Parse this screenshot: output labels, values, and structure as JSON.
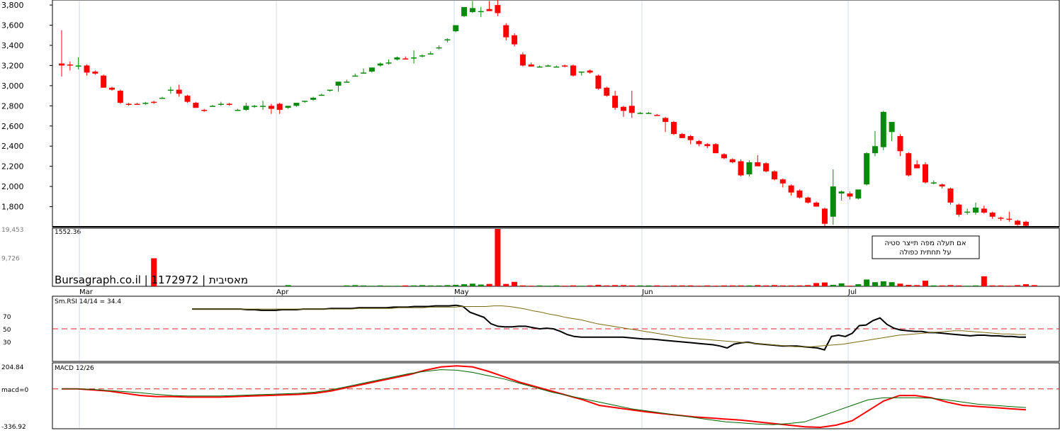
{
  "chart_data": [
    {
      "type": "candlestick",
      "name_label": "",
      "ylim": [
        1600,
        3850
      ],
      "y_ticks": [
        "3,800",
        "3,600",
        "3,400",
        "3,200",
        "3,000",
        "2,800",
        "2,600",
        "2,400",
        "2,200",
        "2,000",
        "1,800"
      ],
      "y_tick_values": [
        3800,
        3600,
        3400,
        3200,
        3000,
        2800,
        2600,
        2400,
        2200,
        2000,
        1800
      ],
      "x_labels": [
        "Mar",
        "Apr",
        "May",
        "Jun",
        "Jul"
      ],
      "up_color": "#0a8a0a",
      "down_color": "#ff0000",
      "candles": [
        [
          3220,
          3550,
          3090,
          3200
        ],
        [
          3210,
          3240,
          3150,
          3200
        ],
        [
          3200,
          3280,
          3160,
          3200
        ],
        [
          3200,
          3210,
          3100,
          3130
        ],
        [
          3140,
          3150,
          3110,
          3120
        ],
        [
          3100,
          3110,
          2980,
          2980
        ],
        [
          2980,
          2990,
          2950,
          2960
        ],
        [
          2950,
          2960,
          2820,
          2830
        ],
        [
          2820,
          2830,
          2800,
          2810
        ],
        [
          2820,
          2830,
          2810,
          2810
        ],
        [
          2820,
          2840,
          2810,
          2830
        ],
        [
          2840,
          2850,
          2820,
          2830
        ],
        [
          2880,
          2890,
          2870,
          2880
        ],
        [
          2960,
          2990,
          2920,
          2960
        ],
        [
          2960,
          3010,
          2890,
          2920
        ],
        [
          2900,
          2910,
          2830,
          2840
        ],
        [
          2830,
          2840,
          2780,
          2780
        ],
        [
          2760,
          2770,
          2740,
          2750
        ],
        [
          2800,
          2810,
          2790,
          2800
        ],
        [
          2810,
          2840,
          2800,
          2820
        ],
        [
          2820,
          2830,
          2800,
          2810
        ],
        [
          2760,
          2770,
          2750,
          2760
        ],
        [
          2760,
          2830,
          2750,
          2800
        ],
        [
          2800,
          2810,
          2780,
          2800
        ],
        [
          2800,
          2850,
          2760,
          2800
        ],
        [
          2800,
          2820,
          2720,
          2770
        ],
        [
          2820,
          2830,
          2720,
          2760
        ],
        [
          2780,
          2800,
          2770,
          2800
        ],
        [
          2800,
          2830,
          2790,
          2830
        ],
        [
          2840,
          2850,
          2830,
          2850
        ],
        [
          2860,
          2890,
          2850,
          2880
        ],
        [
          2900,
          2920,
          2900,
          2910
        ],
        [
          2950,
          2960,
          2940,
          2960
        ],
        [
          3000,
          3040,
          2940,
          3040
        ],
        [
          3040,
          3060,
          3030,
          3040
        ],
        [
          3100,
          3120,
          3090,
          3100
        ],
        [
          3130,
          3170,
          3120,
          3130
        ],
        [
          3140,
          3180,
          3130,
          3180
        ],
        [
          3200,
          3230,
          3190,
          3220
        ],
        [
          3220,
          3260,
          3210,
          3230
        ],
        [
          3260,
          3290,
          3250,
          3280
        ],
        [
          3270,
          3290,
          3260,
          3260
        ],
        [
          3280,
          3350,
          3220,
          3280
        ],
        [
          3290,
          3310,
          3280,
          3300
        ],
        [
          3320,
          3340,
          3310,
          3320
        ],
        [
          3380,
          3400,
          3360,
          3380
        ],
        [
          3450,
          3470,
          3430,
          3460
        ],
        [
          3540,
          3600,
          3530,
          3600
        ],
        [
          3690,
          3780,
          3680,
          3780
        ],
        [
          3730,
          3840,
          3720,
          3770
        ],
        [
          3730,
          3780,
          3680,
          3740
        ],
        [
          3760,
          3840,
          3740,
          3740
        ],
        [
          3800,
          3850,
          3690,
          3720
        ],
        [
          3600,
          3620,
          3450,
          3480
        ],
        [
          3500,
          3520,
          3390,
          3410
        ],
        [
          3310,
          3330,
          3190,
          3200
        ],
        [
          3210,
          3230,
          3190,
          3190
        ],
        [
          3190,
          3200,
          3180,
          3190
        ],
        [
          3200,
          3210,
          3190,
          3200
        ],
        [
          3190,
          3200,
          3180,
          3190
        ],
        [
          3200,
          3210,
          3180,
          3190
        ],
        [
          3200,
          3210,
          3090,
          3100
        ],
        [
          3130,
          3140,
          3100,
          3140
        ],
        [
          3150,
          3160,
          3120,
          3130
        ],
        [
          3100,
          3110,
          2960,
          2970
        ],
        [
          2980,
          2990,
          2890,
          2900
        ],
        [
          2900,
          2950,
          2760,
          2780
        ],
        [
          2790,
          2800,
          2690,
          2750
        ],
        [
          2800,
          2950,
          2680,
          2730
        ],
        [
          2730,
          2740,
          2720,
          2730
        ],
        [
          2730,
          2740,
          2720,
          2730
        ],
        [
          2710,
          2720,
          2700,
          2700
        ],
        [
          2680,
          2690,
          2540,
          2640
        ],
        [
          2640,
          2650,
          2510,
          2520
        ],
        [
          2520,
          2530,
          2480,
          2480
        ],
        [
          2500,
          2510,
          2420,
          2460
        ],
        [
          2450,
          2460,
          2400,
          2420
        ],
        [
          2420,
          2430,
          2380,
          2400
        ],
        [
          2420,
          2430,
          2330,
          2330
        ],
        [
          2320,
          2330,
          2270,
          2280
        ],
        [
          2270,
          2280,
          2230,
          2240
        ],
        [
          2250,
          2270,
          2100,
          2110
        ],
        [
          2120,
          2260,
          2100,
          2240
        ],
        [
          2240,
          2310,
          2200,
          2200
        ],
        [
          2230,
          2240,
          2140,
          2150
        ],
        [
          2150,
          2160,
          2060,
          2070
        ],
        [
          2070,
          2080,
          1990,
          2030
        ],
        [
          2010,
          2020,
          1910,
          1940
        ],
        [
          1960,
          1970,
          1880,
          1890
        ],
        [
          1890,
          1900,
          1830,
          1840
        ],
        [
          1840,
          1850,
          1800,
          1800
        ],
        [
          1780,
          1790,
          1600,
          1630
        ],
        [
          1700,
          2170,
          1620,
          2000
        ],
        [
          1930,
          1960,
          1860,
          1950
        ],
        [
          1930,
          1950,
          1870,
          1900
        ],
        [
          1880,
          1960,
          1870,
          1970
        ],
        [
          2020,
          2340,
          2010,
          2330
        ],
        [
          2330,
          2550,
          2300,
          2400
        ],
        [
          2390,
          2750,
          2360,
          2740
        ],
        [
          2540,
          2640,
          2450,
          2640
        ],
        [
          2500,
          2520,
          2300,
          2350
        ],
        [
          2330,
          2340,
          2100,
          2110
        ],
        [
          2220,
          2260,
          2180,
          2180
        ],
        [
          2220,
          2240,
          2030,
          2040
        ],
        [
          2040,
          2060,
          2020,
          2040
        ],
        [
          2020,
          2030,
          1980,
          2000
        ],
        [
          1980,
          1990,
          1820,
          1840
        ],
        [
          1820,
          1830,
          1700,
          1720
        ],
        [
          1740,
          1780,
          1720,
          1750
        ],
        [
          1740,
          1840,
          1720,
          1790
        ],
        [
          1780,
          1810,
          1730,
          1740
        ],
        [
          1740,
          1750,
          1680,
          1700
        ],
        [
          1690,
          1700,
          1660,
          1680
        ],
        [
          1680,
          1750,
          1650,
          1670
        ],
        [
          1660,
          1670,
          1610,
          1620
        ],
        [
          1650,
          1660,
          1600,
          1610
        ]
      ]
    },
    {
      "type": "bar",
      "name_label": "Volume",
      "y_ticks": [
        "19,453",
        "9,726"
      ],
      "y_tick_values": [
        19453,
        9726
      ],
      "ylim": [
        0,
        19453
      ],
      "max_label": "1552.36",
      "watermark": "Bursagraph.co.il | 1172972 | מאסיבית",
      "note_line1": "אם תעלה מפה תייצר סטיה",
      "note_line2": "על תחתית כפולה",
      "values": [
        0,
        0,
        0,
        0,
        0,
        0,
        0,
        0,
        0,
        0,
        0,
        9500,
        0,
        0,
        0,
        0,
        0,
        0,
        0,
        0,
        0,
        0,
        0,
        0,
        0,
        0,
        0,
        400,
        0,
        0,
        0,
        0,
        0,
        0,
        300,
        400,
        300,
        200,
        300,
        200,
        200,
        300,
        300,
        400,
        300,
        300,
        400,
        500,
        700,
        900,
        600,
        800,
        21000,
        800,
        1500,
        300,
        200,
        300,
        200,
        300,
        200,
        300,
        200,
        300,
        500,
        300,
        400,
        400,
        300,
        300,
        300,
        300,
        200,
        300,
        300,
        300,
        200,
        300,
        200,
        300,
        300,
        300,
        300,
        400,
        300,
        400,
        300,
        300,
        300,
        400,
        1100,
        1300,
        500,
        1000,
        200,
        700,
        2300,
        1400,
        1700,
        1400,
        900,
        500,
        400,
        1900,
        300,
        300,
        400,
        300,
        200,
        300,
        3400,
        300,
        300,
        200,
        400,
        700,
        400
      ]
    },
    {
      "type": "line",
      "name_label": "Sm.RSI 14/14 = 34.4",
      "y_ticks": [
        "70",
        "50",
        "30"
      ],
      "y_tick_values": [
        70,
        50,
        30
      ],
      "ylim": [
        0,
        100
      ],
      "ref_level": 50,
      "x_labels": [
        "Mar",
        "Apr",
        "May",
        "Jun",
        "Jul"
      ],
      "series": [
        {
          "color": "#000000",
          "values": [
            81,
            81,
            81,
            81,
            81,
            81,
            81,
            81,
            80,
            80,
            79,
            79,
            79,
            80,
            80,
            80,
            81,
            81,
            81,
            81,
            82,
            82,
            82,
            82,
            83,
            83,
            83,
            83,
            83,
            84,
            84,
            84,
            85,
            85,
            85,
            86,
            86,
            86,
            87,
            85,
            76,
            72,
            68,
            58,
            54,
            53,
            53,
            54,
            54,
            52,
            50,
            51,
            50,
            46,
            41,
            38,
            37,
            37,
            37,
            37,
            37,
            37,
            37,
            36,
            35,
            34,
            34,
            33,
            32,
            31,
            30,
            29,
            28,
            27,
            26,
            25,
            23,
            20,
            26,
            28,
            29,
            27,
            26,
            25,
            24,
            23,
            23,
            23,
            22,
            21,
            20,
            17,
            38,
            40,
            38,
            43,
            55,
            56,
            63,
            67,
            57,
            51,
            48,
            47,
            46,
            46,
            44,
            44,
            43,
            42,
            41,
            40,
            39,
            40,
            40,
            39,
            39,
            38,
            38,
            37,
            37
          ]
        },
        {
          "color": "#7a6a12",
          "values": [
            81,
            81,
            81,
            81,
            81,
            81,
            81,
            81,
            81,
            81,
            81,
            81,
            81,
            81,
            81,
            81,
            81,
            81,
            81,
            81,
            81,
            82,
            82,
            82,
            82,
            82,
            83,
            83,
            83,
            83,
            84,
            84,
            84,
            84,
            85,
            85,
            85,
            85,
            86,
            86,
            85,
            83,
            81,
            78,
            76,
            73,
            71,
            68,
            66,
            64,
            61,
            58,
            56,
            54,
            52,
            50,
            48,
            46,
            44,
            42,
            40,
            38,
            36,
            35,
            34,
            33,
            32,
            31,
            30,
            29,
            28,
            27,
            26,
            25,
            24,
            23,
            22,
            22,
            22,
            23,
            24,
            25,
            26,
            28,
            30,
            32,
            34,
            36,
            38,
            40,
            41,
            42,
            43,
            44,
            45,
            46,
            47,
            47,
            46,
            45,
            44,
            43,
            42,
            42,
            41,
            41
          ]
        }
      ]
    },
    {
      "type": "line",
      "name_label": "MACD 12/26",
      "y_ticks": [
        "204.84",
        "macd=0",
        "-336.92"
      ],
      "y_tick_values": [
        204.84,
        0,
        -336.92
      ],
      "ylim": [
        -336.92,
        204.84
      ],
      "ref_level": 0,
      "series": [
        {
          "color": "#ff0000",
          "values": [
            0,
            0,
            -10,
            -20,
            -40,
            -60,
            -70,
            -70,
            -75,
            -75,
            -75,
            -70,
            -65,
            -60,
            -55,
            -50,
            -40,
            -20,
            10,
            40,
            70,
            100,
            130,
            170,
            200,
            210,
            200,
            160,
            110,
            60,
            20,
            -20,
            -60,
            -100,
            -150,
            -170,
            -190,
            -210,
            -225,
            -240,
            -255,
            -265,
            -275,
            -285,
            -300,
            -315,
            -330,
            -345,
            -350,
            -330,
            -290,
            -200,
            -110,
            -60,
            -60,
            -80,
            -120,
            -150,
            -160,
            -170,
            -180,
            -190
          ]
        },
        {
          "color": "#006400",
          "values": [
            0,
            0,
            -5,
            -15,
            -25,
            -35,
            -50,
            -60,
            -65,
            -65,
            -65,
            -60,
            -55,
            -50,
            -45,
            -40,
            -30,
            -10,
            20,
            50,
            80,
            110,
            140,
            160,
            175,
            170,
            150,
            120,
            90,
            50,
            10,
            -30,
            -60,
            -90,
            -120,
            -150,
            -180,
            -200,
            -220,
            -240,
            -260,
            -280,
            -300,
            -310,
            -320,
            -325,
            -315,
            -300,
            -250,
            -200,
            -150,
            -100,
            -80,
            -80,
            -80,
            -85,
            -100,
            -120,
            -140,
            -150,
            -160,
            -170
          ]
        }
      ]
    }
  ]
}
